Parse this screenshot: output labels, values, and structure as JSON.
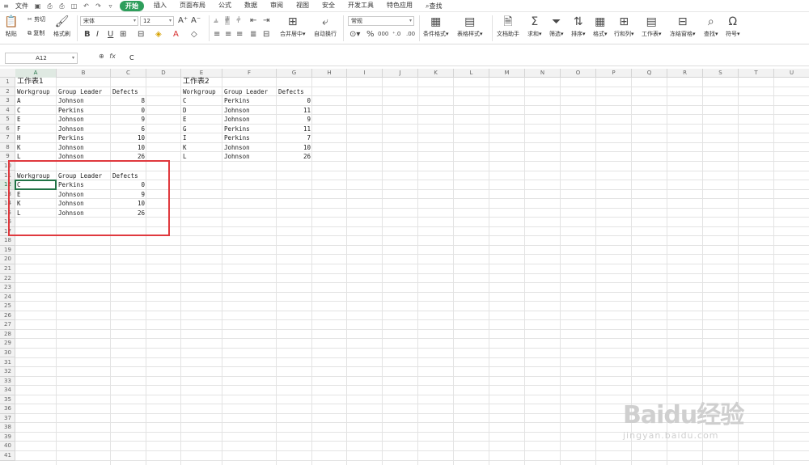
{
  "menu": {
    "file": "文件",
    "items": [
      "开始",
      "插入",
      "页面布局",
      "公式",
      "数据",
      "审阅",
      "视图",
      "安全",
      "开发工具",
      "特色应用"
    ],
    "active_index": 0,
    "search": "查找"
  },
  "ribbon": {
    "paste": "粘贴",
    "cut": "剪切",
    "copy": "复制",
    "format_painter": "格式刷",
    "font_name": "宋体",
    "font_size": "12",
    "merge_center": "合并居中",
    "wrap_text": "自动换行",
    "number_format": "常规",
    "conditional_format": "条件格式",
    "table_style": "表格样式",
    "doc_assistant": "文档助手",
    "sum": "求和",
    "filter": "筛选",
    "sort": "排序",
    "format": "格式",
    "row_col": "行和列",
    "worksheet": "工作表",
    "freeze": "冻结窗格",
    "find": "查找",
    "symbol": "符号"
  },
  "formula_bar": {
    "name_box": "A12",
    "fx_label": "fx",
    "value": "C"
  },
  "sheet": {
    "columns": [
      "A",
      "B",
      "C",
      "D",
      "E",
      "F",
      "G",
      "H",
      "I",
      "J",
      "K",
      "L",
      "M",
      "N",
      "O",
      "P",
      "Q",
      "R",
      "S",
      "T",
      "U"
    ],
    "selected_column": "A",
    "selected_row": 12,
    "row_count": 41,
    "table1": {
      "title": "工作表1",
      "headers": [
        "Workgroup",
        "Group Leader",
        "Defects"
      ],
      "rows": [
        [
          "A",
          "Johnson",
          "8"
        ],
        [
          "C",
          "Perkins",
          "0"
        ],
        [
          "E",
          "Johnson",
          "9"
        ],
        [
          "F",
          "Johnson",
          "6"
        ],
        [
          "H",
          "Perkins",
          "10"
        ],
        [
          "K",
          "Johnson",
          "10"
        ],
        [
          "L",
          "Johnson",
          "26"
        ]
      ]
    },
    "table2": {
      "title": "工作表2",
      "headers": [
        "Workgroup",
        "Group Leader",
        "Defects"
      ],
      "rows": [
        [
          "C",
          "Perkins",
          "0"
        ],
        [
          "D",
          "Johnson",
          "11"
        ],
        [
          "E",
          "Johnson",
          "9"
        ],
        [
          "G",
          "Perkins",
          "11"
        ],
        [
          "I",
          "Perkins",
          "7"
        ],
        [
          "K",
          "Johnson",
          "10"
        ],
        [
          "L",
          "Johnson",
          "26"
        ]
      ]
    },
    "result": {
      "headers": [
        "Workgroup",
        "Group Leader",
        "Defects"
      ],
      "rows": [
        [
          "C",
          "Perkins",
          "0"
        ],
        [
          "E",
          "Johnson",
          "9"
        ],
        [
          "K",
          "Johnson",
          "10"
        ],
        [
          "L",
          "Johnson",
          "26"
        ]
      ]
    }
  },
  "watermark": {
    "logo": "Baidu经验",
    "url": "jingyan.baidu.com"
  },
  "colors": {
    "accent": "#2e9e5b",
    "selection": "#217346",
    "highlight": "#e0393e"
  }
}
